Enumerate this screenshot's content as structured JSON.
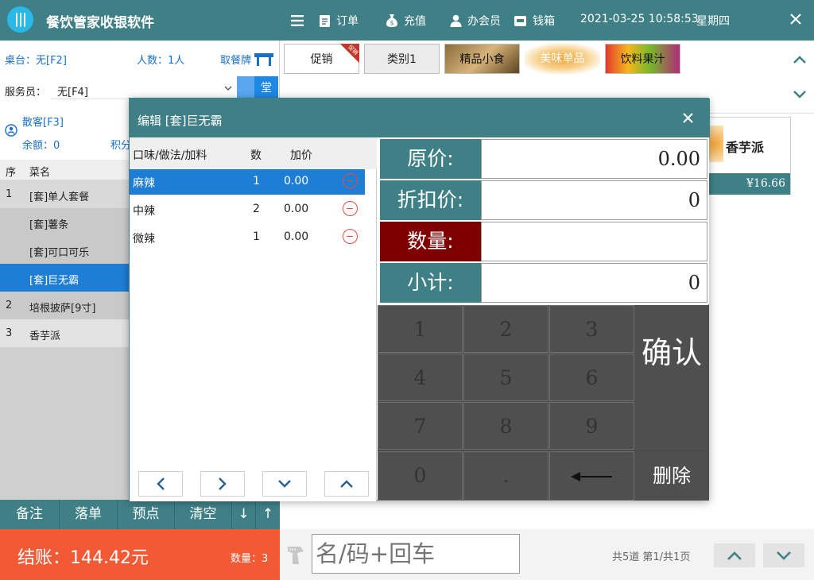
{
  "header": {
    "title": "餐饮管家收银软件",
    "menu_icon": "menu-icon",
    "buttons": [
      {
        "label": "订单",
        "icon": "document-icon"
      },
      {
        "label": "充值",
        "icon": "money-bag-icon"
      },
      {
        "label": "办会员",
        "icon": "user-icon"
      },
      {
        "label": "钱箱",
        "icon": "cash-drawer-icon"
      }
    ],
    "datetime": "2021-03-25 10:58:53",
    "weekday": "星期四"
  },
  "left": {
    "table_label": "桌台：无[F2]",
    "people_label": "人数：1人",
    "take_number_label": "取餐牌",
    "staff_label": "服务员：",
    "staff_value": "无[F4]",
    "dine_label": "堂",
    "guest_label": "散客[F3]",
    "balance_label": "余额：0",
    "points_label": "积分",
    "order_headers": {
      "seq": "序",
      "name": "菜名"
    },
    "order_rows": [
      {
        "seq": "1",
        "name": "[套]单人套餐"
      },
      {
        "seq": "",
        "name": "[套]薯条"
      },
      {
        "seq": "",
        "name": "[套]可口可乐"
      },
      {
        "seq": "",
        "name": "[套]巨无霸"
      },
      {
        "seq": "2",
        "name": "培根披萨[9寸]"
      },
      {
        "seq": "3",
        "name": "香芋派"
      }
    ],
    "actions": [
      "备注",
      "落单",
      "预点",
      "清空",
      "↓",
      "↑"
    ],
    "checkout_label": "结账：144.42元",
    "qty_label": "数量：3"
  },
  "categories": [
    "促销",
    "类别1",
    "精品小食",
    "美味单品",
    "饮料果汁"
  ],
  "promo_badge": "促销",
  "dish_card": {
    "name": "香芋派",
    "price": "¥16.66"
  },
  "search": {
    "placeholder": "名/码+回车"
  },
  "pager": {
    "info": "共5道  第1/共1页"
  },
  "modal": {
    "title": "编辑   [套]巨无霸",
    "option_headers": {
      "name": "口味/做法/加料",
      "qty": "数",
      "price": "加价"
    },
    "options": [
      {
        "name": "麻辣",
        "qty": "1",
        "price": "0.00"
      },
      {
        "name": "中辣",
        "qty": "2",
        "price": "0.00"
      },
      {
        "name": "微辣",
        "qty": "1",
        "price": "0.00"
      }
    ],
    "fields": [
      {
        "label": "原价:",
        "value": "0.00"
      },
      {
        "label": "折扣价:",
        "value": "0"
      },
      {
        "label": "数量:",
        "value": ""
      },
      {
        "label": "小计:",
        "value": "0"
      }
    ],
    "keys": [
      "1",
      "2",
      "3",
      "4",
      "5",
      "6",
      "7",
      "8",
      "9",
      "0",
      "."
    ],
    "confirm": "确认",
    "delete": "删除",
    "colors": {
      "teal": "#3f8087",
      "active_field": "#7f0000",
      "selected": "#1e7ed6"
    }
  }
}
